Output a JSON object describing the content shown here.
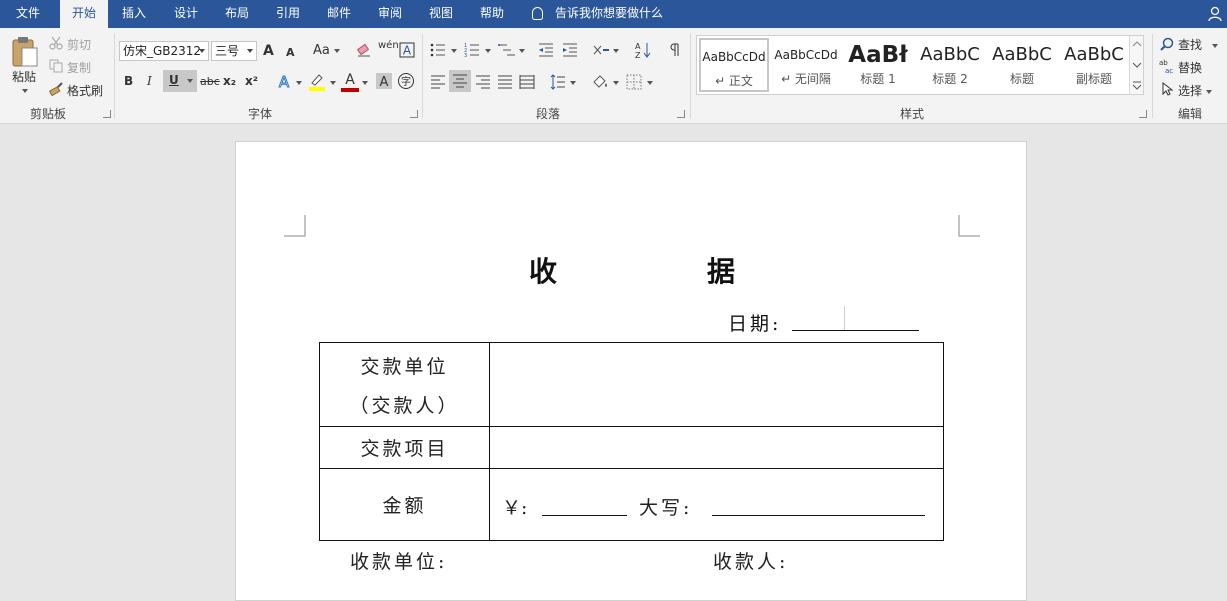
{
  "tabs": [
    {
      "label": "文件",
      "active": false
    },
    {
      "label": "开始",
      "active": true
    },
    {
      "label": "插入",
      "active": false
    },
    {
      "label": "设计",
      "active": false
    },
    {
      "label": "布局",
      "active": false
    },
    {
      "label": "引用",
      "active": false
    },
    {
      "label": "邮件",
      "active": false
    },
    {
      "label": "审阅",
      "active": false
    },
    {
      "label": "视图",
      "active": false
    },
    {
      "label": "帮助",
      "active": false
    }
  ],
  "tell_me": "告诉我你想要做什么",
  "clipboard": {
    "paste": "粘贴",
    "cut": "剪切",
    "copy": "复制",
    "format_painter": "格式刷",
    "group": "剪贴板"
  },
  "font": {
    "family": "仿宋_GB2312",
    "size": "三号",
    "group": "字体",
    "bold": "B",
    "italic": "I",
    "underline": "U",
    "strike": "abc",
    "subscript": "x₂",
    "superscript": "x²",
    "case": "Aa",
    "grow": "A",
    "shrink": "A",
    "color_a": "A",
    "phonetic": "wén"
  },
  "paragraph": {
    "group": "段落"
  },
  "styles": {
    "group": "样式",
    "items": [
      {
        "sample": "AaBbCcDd",
        "name": "↵ 正文",
        "selected": true
      },
      {
        "sample": "AaBbCcDd",
        "name": "↵ 无间隔",
        "selected": false
      },
      {
        "sample": "AaBł",
        "name": "标题 1",
        "selected": false
      },
      {
        "sample": "AaBbC",
        "name": "标题 2",
        "selected": false
      },
      {
        "sample": "AaBbC",
        "name": "标题",
        "selected": false
      },
      {
        "sample": "AaBbC",
        "name": "副标题",
        "selected": false
      }
    ]
  },
  "editing": {
    "find": "查找",
    "replace": "替换",
    "select": "选择",
    "group": "编辑"
  },
  "document": {
    "title_left": "收",
    "title_right": "据",
    "date_label": "日期:",
    "rows": [
      {
        "label_line1": "交款单位",
        "label_line2": "（交款人）"
      },
      {
        "label": "交款项目"
      },
      {
        "label": "金额",
        "yen": "￥:",
        "daxie": "大写:"
      }
    ],
    "footer_left": "收款单位:",
    "footer_right": "收款人:"
  },
  "colors": {
    "tab_bar": "#2b579a",
    "ribbon": "#f3f3f3",
    "canvas": "#e6e6e6",
    "highlight": "#ffff00",
    "font_color": "#c00000"
  }
}
